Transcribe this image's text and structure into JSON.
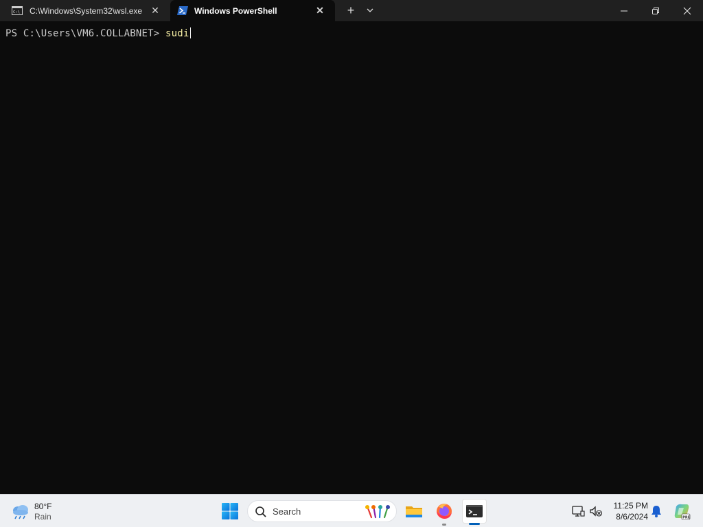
{
  "window": {
    "tabs": [
      {
        "label": "C:\\Windows\\System32\\wsl.exe",
        "active": false
      },
      {
        "label": "Windows PowerShell",
        "active": true
      }
    ],
    "new_tab_label": "+",
    "close_glyph": "✕"
  },
  "terminal": {
    "prompt": "PS C:\\Users\\VM6.COLLABNET> ",
    "command": "sudi"
  },
  "taskbar": {
    "weather": {
      "temp": "80°F",
      "desc": "Rain"
    },
    "search": {
      "placeholder": "Search"
    },
    "clock": {
      "time": "11:25 PM",
      "date": "8/6/2024"
    },
    "apps": [
      "file-explorer",
      "firefox",
      "windows-terminal"
    ]
  },
  "colors": {
    "terminal_bg": "#0c0c0c",
    "titlebar_bg": "#202020",
    "prompt_text": "#cccccc",
    "command_text": "#f9f1a5",
    "taskbar_bg": "#eef0f3",
    "accent": "#005fb8"
  },
  "icons": {
    "tab1": "cmd-console-icon",
    "tab2": "powershell-icon",
    "taskbar": [
      "weather-rain-icon",
      "windows-start-icon",
      "search-icon",
      "file-explorer-icon",
      "firefox-icon",
      "terminal-icon",
      "display-icon",
      "sound-muted-icon",
      "notification-bell-icon",
      "copilot-icon"
    ]
  }
}
